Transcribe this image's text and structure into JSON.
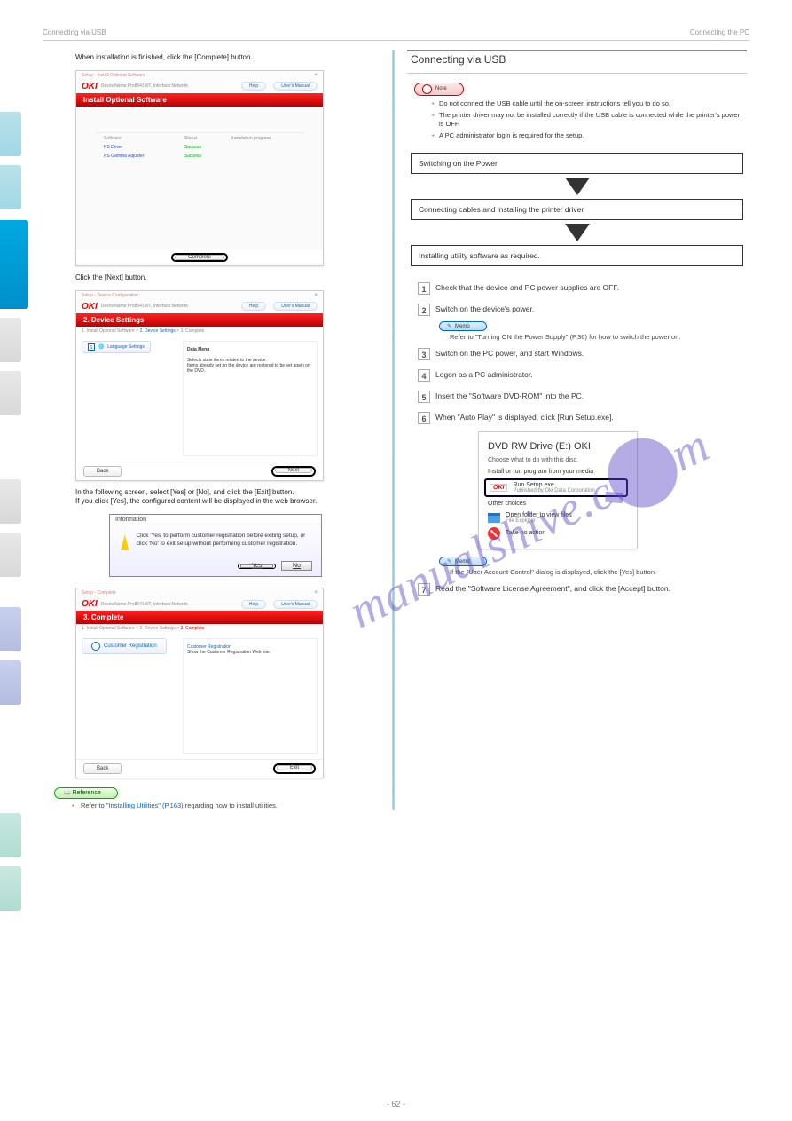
{
  "header_left": "Connecting via USB",
  "header_right": "Connecting the PC",
  "page_number": "- 62 -",
  "left": {
    "step8": "When installation is finished, click the [Complete] button.",
    "step9": "Click the [Next] button.",
    "step10": "In the following screen, select [Yes] or [No], and click the [Exit] button.",
    "step10_sub": "If you click [Yes], the configured content will be displayed in the web browser."
  },
  "dialog1": {
    "window": "Setup - Install Optional Software",
    "devname": "DeviceName:Pro8541WT, Interface:Network",
    "help": "Help",
    "manual": "User's Manual",
    "bar": "Install Optional Software",
    "col1": "Software",
    "col2": "Status",
    "col3": "Installation progress",
    "r1a": "PS Driver",
    "r1b": "Success",
    "r2a": "PS Gamma Adjuster",
    "r2b": "Success",
    "complete": "Complete"
  },
  "dialog2": {
    "window": "Setup - Device Configuration",
    "devname": "DeviceName:Pro8541WT, Interface:Network",
    "bar": "2. Device Settings",
    "crumbs_a": "1. Install Optional Software",
    "crumbs_b": "2. Device Settings",
    "crumbs_c": "3. Complete",
    "num": "1",
    "lang": "Language Settings",
    "ptitle": "Data Menu",
    "p1": "Selects state items related to the device.",
    "p2": "Items already set on the device are restored to be set again on the DVD.",
    "back": "Back",
    "next": "Next"
  },
  "info": {
    "title": "Information",
    "body": "Click 'Yes' to perform customer registration before exiting setup, or click 'No' to exit setup without performing customer registration.",
    "yes": "Yes",
    "no": "No"
  },
  "dialog3": {
    "window": "Setup - Complete",
    "devname": "DeviceName:Pro8541WT, Interface:Network",
    "bar": "3. Complete",
    "crumbs_a": "1. Install Optional Software",
    "crumbs_b": "2. Device Settings",
    "crumbs_c": "3. Complete",
    "reg": "Customer Registration",
    "rtitle": "Customer Registration",
    "rtext": "Show the Customer Registration Web site.",
    "back": "Back",
    "exit": "Exit"
  },
  "reference_label": "Reference",
  "refs": [
    {
      "t": "Refer to ",
      "l": "\"Installing Utilities\" (P.163)",
      "a": " regarding how to install utilities."
    }
  ],
  "right": {
    "section": "Connecting via USB",
    "note_label": "Note",
    "notes": [
      "Do not connect the USB cable until the on-screen instructions tell you to do so.",
      "The printer driver may not be installed correctly if the USB cable is connected while the printer's power is OFF.",
      "A PC administrator login is required for the setup."
    ],
    "flow": [
      "Switching on the Power",
      "Connecting cables and installing the printer driver",
      "Installing utility software as required."
    ],
    "step1": "Check that the device and PC power supplies are OFF.",
    "step2": "Switch on the device's power.",
    "memo_label": "Memo",
    "memo2": "Refer to \"Turning ON the Power Supply\" (P.36) for how to switch the power on.",
    "step3": "Switch on the PC power, and start Windows.",
    "step4": "Logon as a PC administrator.",
    "step5": "Insert the \"Software DVD-ROM\" into the PC.",
    "step6": "When \"Auto Play\" is displayed, click [Run Setup.exe].",
    "memo6": "If the \"User Account Control\" dialog is displayed, click the [Yes] button.",
    "step7": "Read the \"Software License Agreement\", and click the [Accept] button."
  },
  "autoplay": {
    "title": "DVD RW Drive (E:) OKI",
    "sub": "Choose what to do with this disc.",
    "sect1": "Install or run program from your media",
    "run": "Run Setup.exe",
    "runsub": "Published by Oki Data Corporation",
    "sect2": "Other choices",
    "open": "Open folder to view files",
    "opensub": "File Explorer",
    "none": "Take no action"
  }
}
